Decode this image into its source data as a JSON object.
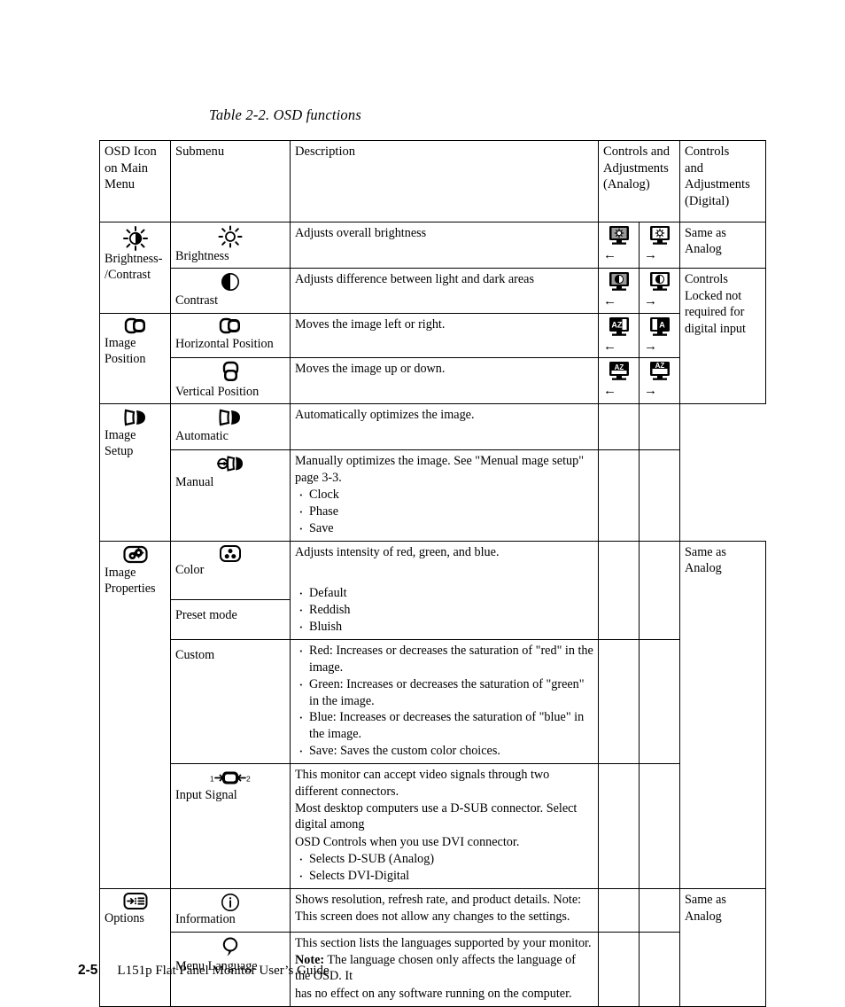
{
  "caption": "Table 2-2. OSD functions",
  "headers": {
    "osd_icon": "OSD Icon on Main Menu",
    "submenu": "Submenu",
    "description": "Description",
    "analog": "Controls and Adjustments (Analog)",
    "digital": "Controls and Adjustments (Digital)"
  },
  "groups": {
    "brightness_contrast": {
      "menu_label_line1": "Brightness-",
      "menu_label_line2": "/Contrast",
      "icon": "brightness-contrast-icon",
      "digital_note": "Same as Analog",
      "digital_note2_line1": "Controls",
      "digital_note2_line2": "Locked not",
      "digital_note2_line3": "required for",
      "digital_note2_line4": "digital input",
      "rows": [
        {
          "submenu": "Brightness",
          "icon": "sun-icon",
          "description": "Adjusts overall brightness",
          "analog_left_icon": "monitor-brightness-decrease-icon",
          "analog_left_arrow": "←",
          "analog_right_icon": "monitor-brightness-increase-icon",
          "analog_right_arrow": "→"
        },
        {
          "submenu": "Contrast",
          "icon": "contrast-icon",
          "description": "Adjusts difference between light and dark areas",
          "analog_left_icon": "monitor-contrast-decrease-icon",
          "analog_left_arrow": "←",
          "analog_right_icon": "monitor-contrast-increase-icon",
          "analog_right_arrow": "→"
        }
      ]
    },
    "image_position": {
      "menu_label_line1": "Image",
      "menu_label_line2": "Position",
      "icon": "image-position-icon",
      "rows": [
        {
          "submenu": "Horizontal Position",
          "icon": "horizontal-position-icon",
          "description": "Moves the image left or right.",
          "analog_left_icon": "monitor-hpos-left-icon",
          "analog_left_arrow": "←",
          "analog_right_icon": "monitor-hpos-right-icon",
          "analog_right_arrow": "→"
        },
        {
          "submenu": "Vertical Position",
          "icon": "vertical-position-icon",
          "description": "Moves the image up or down.",
          "analog_left_icon": "monitor-vpos-down-icon",
          "analog_left_arrow": "←",
          "analog_right_icon": "monitor-vpos-up-icon",
          "analog_right_arrow": "→"
        }
      ]
    },
    "image_setup": {
      "menu_label_line1": "Image",
      "menu_label_line2": "Setup",
      "icon": "image-setup-icon",
      "rows": [
        {
          "submenu": "Automatic",
          "icon": "automatic-icon",
          "description": "Automatically optimizes the image."
        },
        {
          "submenu": "Manual",
          "icon": "manual-icon",
          "description": "Manually optimizes the image. See  \"Menual mage setup\" page 3-3.",
          "bullets": [
            "Clock",
            "Phase",
            "Save"
          ]
        }
      ]
    },
    "image_properties": {
      "menu_label_line1": "Image",
      "menu_label_line2": "Properties",
      "icon": "image-properties-icon",
      "digital_note_line1": "Same as",
      "digital_note_line2": "Analog",
      "rows": [
        {
          "submenu": "Color",
          "icon": "color-icon",
          "description": "Adjusts intensity of red, green, and blue."
        },
        {
          "submenu": "Preset mode",
          "bullets": [
            "Default",
            "Reddish",
            "Bluish"
          ]
        },
        {
          "submenu": "Custom",
          "bullets": [
            "Red: Increases or decreases the saturation of \"red\" in the image.",
            "Green: Increases or decreases the saturation of \"green\" in the image.",
            "Blue: Increases or decreases the saturation of \"blue\"  in the image.",
            "Save: Saves the custom color choices."
          ]
        },
        {
          "submenu": "Input  Signal",
          "icon": "input-signal-icon",
          "icon_label_left": "1",
          "icon_label_right": "2",
          "description_lines": [
            "This monitor can accept video signals through two different connectors.",
            "Most desktop computers use a D-SUB connector. Select digital among",
            "OSD Controls when you use DVI connector."
          ],
          "bullets": [
            "Selects D-SUB (Analog)",
            "Selects DVI-Digital"
          ]
        }
      ]
    },
    "options": {
      "menu_label_line1": "Options",
      "icon": "options-icon",
      "digital_note_line1": "Same as",
      "digital_note_line2": "Analog",
      "rows": [
        {
          "submenu": "Information",
          "icon": "information-icon",
          "description": "Shows resolution, refresh rate, and product details. Note: This screen does not allow any changes to the settings."
        },
        {
          "submenu": "Menu Language",
          "icon": "menu-language-icon",
          "description_line1": "This section lists the languages supported by your monitor.",
          "note_label": "Note:",
          "description_line2": " The language chosen only affects the language of the OSD. It",
          "description_line3": "has no effect on any software running on the computer."
        }
      ]
    }
  },
  "footer": {
    "page_number": "2-5",
    "title": "L151p Flat Panel Monitor User’s Guide"
  }
}
